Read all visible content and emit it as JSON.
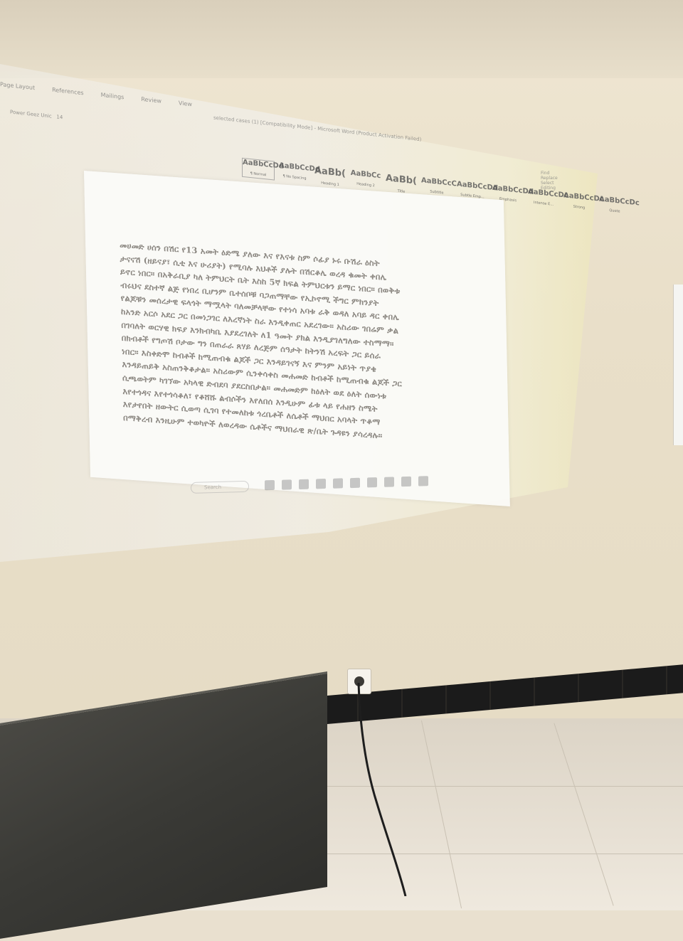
{
  "word": {
    "tabs": [
      "Page Layout",
      "References",
      "Mailings",
      "Review",
      "View"
    ],
    "title_bar": "selected cases (1) [Compatibility Mode] - Microsoft Word (Product Activation Failed)",
    "font_name": "Power Geez Unic",
    "font_size": "14",
    "styles": [
      {
        "sample": "AaBbCcDd",
        "label": "¶ Normal"
      },
      {
        "sample": "AaBbCcDd",
        "label": "¶ No Spacing"
      },
      {
        "sample": "AaBb(",
        "label": "Heading 1"
      },
      {
        "sample": "AaBbCc",
        "label": "Heading 2"
      },
      {
        "sample": "AaBb(",
        "label": "Title"
      },
      {
        "sample": "AaBbCcC",
        "label": "Subtitle"
      },
      {
        "sample": "AaBbCcDd",
        "label": "Subtle Emp..."
      },
      {
        "sample": "AaBbCcDd",
        "label": "Emphasis"
      },
      {
        "sample": "AaBbCcDc",
        "label": "Intense E..."
      },
      {
        "sample": "AaBbCcDc",
        "label": "Strong"
      },
      {
        "sample": "AaBbCcDc",
        "label": "Quote"
      }
    ],
    "right_panel": [
      "Find",
      "Replace",
      "Select",
      "Editing"
    ],
    "taskbar_search": "Search"
  },
  "document": {
    "lines": [
      "መሀመድ ሀሰን በሽር የ13 አመት ዕድሜ ያለው እና የእናቱ ስም ሶፊያ ኑሩ ቡሽራ ዕስት",
      "ታናናሽ (ዘይናያ፣ ሲቲ እና ሁሪያት) የሚባሉ እህቶች ያሉት በሽርቆሌ ወረዳ ቁመት ቀበሌ",
      "ይኖር ነበር። በአቅራቢያ ካለ ትምህርት ቤት እስከ 5ኛ ክፍል ትምህርቱን ይማር ነበር። በወቅቱ",
      "ብሩህና ደስተኛ ልጅ የነበረ ቢሆንም ቤተሰቦቹ ባጋጠማቸው የኢኮኖሚ ችግር ምክንያት",
      "የልጆቹን መሰረታዊ ፍላጎት ማሟላት ባለመቻላቸው የተነሳ አባቱ ራቅ ወዳለ አባይ ዳር ቀበሌ",
      "ከአንድ አርሶ አደር ጋር በመነጋገር ለእረኛነት ስራ እንዲቀጠር አደረገው። አስሪው ገበሬም ቃል",
      "በገባለት ወርሃዊ ክፍያ እንክብካቤ እያደረገለት ለ1 ዓመት ያክል እንዲያገለግለው ተስማማ።",
      "በክብቶች የግጦሽ ቦታው ግን በጠራራ ጸሃይ ለረጅም ሰዓታት ከትንሽ አረፍት ጋር ይሰራ",
      "ነበር። እስቀድሞ ከብቶች ከሚጠብቁ ልጆች ጋር እንዳይገናኝ እና ምንም አይነት ጥያቄ",
      "እንዳይጠይቅ አስጠንቅቆታል። አስሪውም ሲንቀሳቀስ መሐመድ ከብቶች ከሚጠብቁ ልጆች ጋር",
      "ሲጫወትም ካገኘው አካላዊ ድብደባ ያደርስበታል። መሐመድም ከዕለት ወደ ዕለት ሰውነቱ",
      "እየተጎዳና እየተጎሳቆለ፣ የቆሸሹ ልብሶችን እየለበሰ እንዲሁም ፊቱ ላይ የሐዘን ስሜት",
      "እየታየበት ዘውትር ሲወጣ ሲገባ የተመለከቱ ጎረቤቶች ለሴቶች ማህበር አባላት ጥቆማ",
      "በማቅረብ እንዚሁም ተወካዮች ለወረዳው ሴቶችና ማህበራዊ ጽ/ቤት ጉዳዩን ያሳረዳሉ።"
    ]
  }
}
